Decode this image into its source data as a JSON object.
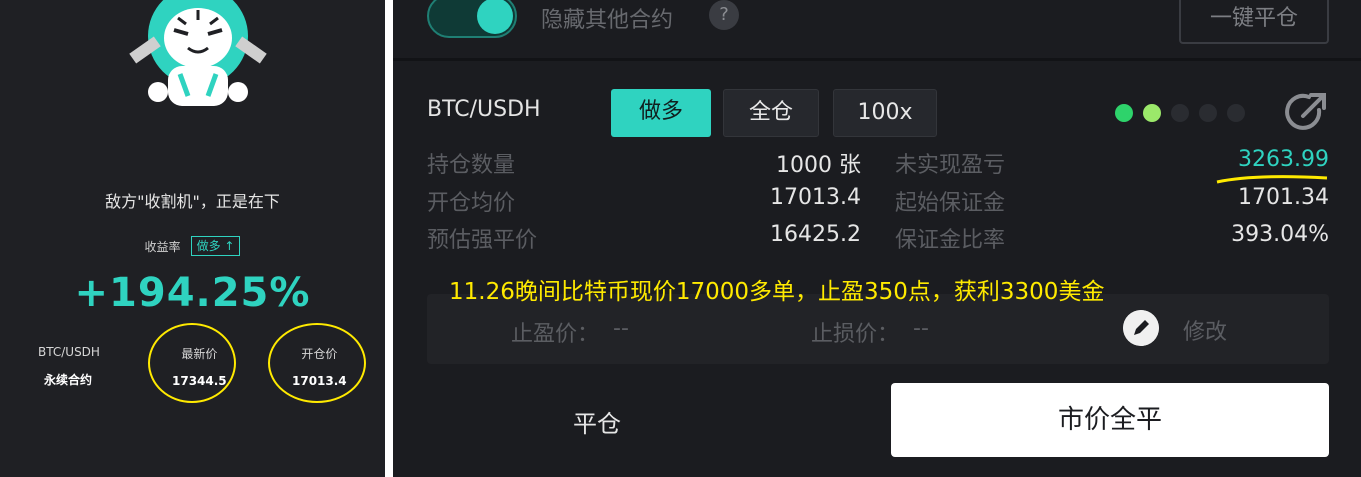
{
  "share_card": {
    "slogan": "敌方\"收割机\"，正是在下",
    "yield_label": "收益率",
    "direction_badge": "做多 ↑",
    "yield_value": "+194.25%",
    "symbol": "BTC/USDH",
    "contract_type": "永续合约",
    "latest_price_label": "最新价",
    "latest_price": "17344.5",
    "open_price_label": "开仓价",
    "open_price": "17013.4"
  },
  "toolbar": {
    "hide_others_label": "隐藏其他合约",
    "help_glyph": "?",
    "close_all_label": "一键平仓"
  },
  "position": {
    "pair": "BTC/USDH",
    "direction": "做多",
    "margin_mode": "全仓",
    "leverage": "100x",
    "size_label": "持仓数量",
    "size_value": "1000 张",
    "unrealized_pnl_label": "未实现盈亏",
    "unrealized_pnl_value": "3263.99",
    "entry_price_label": "开仓均价",
    "entry_price_value": "17013.4",
    "initial_margin_label": "起始保证金",
    "initial_margin_value": "1701.34",
    "liq_price_label": "预估强平价",
    "liq_price_value": "16425.2",
    "margin_ratio_label": "保证金比率",
    "margin_ratio_value": "393.04%"
  },
  "annotation": "11.26晚间比特币现价17000多单，止盈350点，获利3300美金",
  "tpsl": {
    "take_profit_label": "止盈价：",
    "take_profit_value": "--",
    "stop_loss_label": "止损价：",
    "stop_loss_value": "--",
    "edit_label": "修改"
  },
  "actions": {
    "close_label": "平仓",
    "market_close_label": "市价全平"
  },
  "colors": {
    "accent": "#2fd3c0",
    "annotation": "#ffea00",
    "panel_bg": "#1b1c20"
  },
  "icons": [
    "tiger-mascot-icon",
    "help-icon",
    "share-icon",
    "edit-icon"
  ]
}
